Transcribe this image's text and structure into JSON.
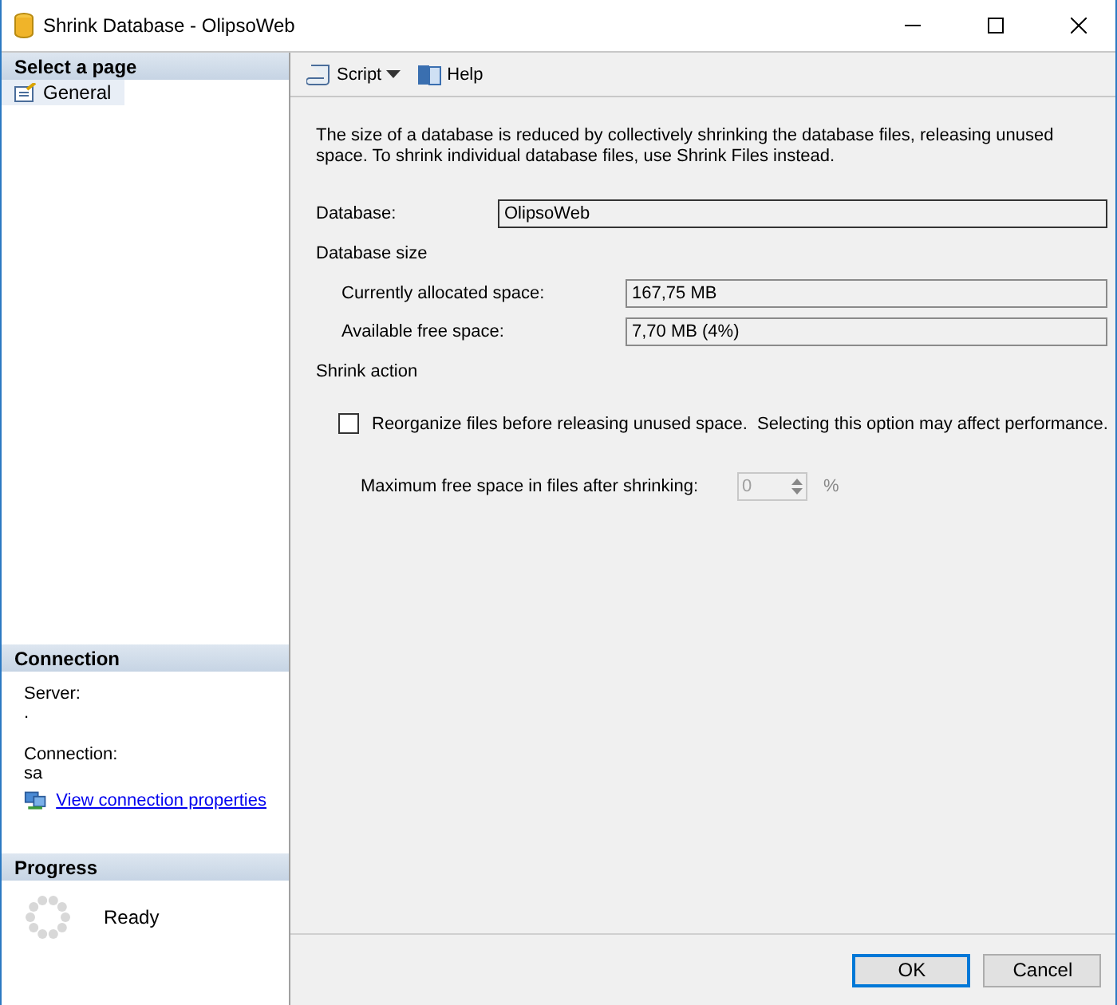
{
  "window": {
    "title": "Shrink Database - OlipsoWeb"
  },
  "sidebar": {
    "select_page": {
      "heading": "Select a page",
      "items": [
        {
          "label": "General",
          "selected": true
        }
      ]
    },
    "connection": {
      "heading": "Connection",
      "server_label": "Server:",
      "server_value": ".",
      "connection_label": "Connection:",
      "connection_value": "sa",
      "link": "View connection properties"
    },
    "progress": {
      "heading": "Progress",
      "status": "Ready"
    }
  },
  "toolbar": {
    "items": [
      {
        "label": "Script",
        "kind": "dropdown"
      },
      {
        "label": "Help",
        "kind": "button"
      }
    ]
  },
  "description": "The size of a database is reduced by collectively shrinking the database files, releasing unused space. To shrink individual database files, use Shrink Files instead.",
  "database": {
    "label": "Database:",
    "value": "OlipsoWeb"
  },
  "database_size": {
    "heading": "Database size",
    "fields": [
      {
        "label": "Currently allocated space:",
        "value": "167,75 MB"
      },
      {
        "label": "Available free space:",
        "value": "7,70 MB (4%)"
      }
    ]
  },
  "shrink_action": {
    "heading": "Shrink action",
    "reorganize": {
      "label": "Reorganize files before releasing unused space.  Selecting this option may affect performance.",
      "checked": false
    },
    "max_free": {
      "label": "Maximum free space in files after shrinking:",
      "value": "0",
      "unit": "%",
      "disabled": true
    }
  },
  "buttons": [
    {
      "label": "OK",
      "default": true
    },
    {
      "label": "Cancel",
      "default": false
    }
  ]
}
